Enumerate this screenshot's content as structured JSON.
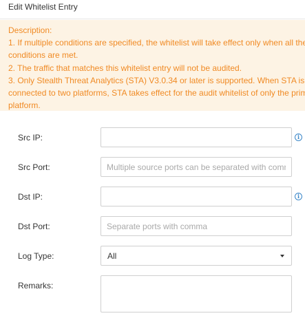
{
  "dialog": {
    "title": "Edit Whitelist Entry"
  },
  "notice": {
    "lines": [
      "Description:",
      "1. If multiple conditions are specified, the whitelist will take effect only when all the",
      "conditions are met.",
      "2. The traffic that matches this whitelist entry will not be audited.",
      "3. Only Stealth Threat Analytics (STA) V3.0.34 or later is supported. When STA is",
      "connected to two platforms, STA takes effect for the audit whitelist of only the prima",
      "platform."
    ],
    "color": "#f08a24",
    "background": "#fdf3e4"
  },
  "form": {
    "src_ip": {
      "label": "Src IP:",
      "value": "",
      "placeholder": ""
    },
    "src_port": {
      "label": "Src Port:",
      "value": "",
      "placeholder": "Multiple source ports can be separated with comma"
    },
    "dst_ip": {
      "label": "Dst IP:",
      "value": "",
      "placeholder": ""
    },
    "dst_port": {
      "label": "Dst Port:",
      "value": "",
      "placeholder": "Separate ports with comma"
    },
    "log_type": {
      "label": "Log Type:",
      "selected": "All"
    },
    "remarks": {
      "label": "Remarks:",
      "value": ""
    }
  },
  "icons": {
    "info": "info-icon",
    "dropdown": "caret-down-icon"
  },
  "colors": {
    "info_icon": "#3a86c8",
    "border": "#cfcfcf"
  }
}
